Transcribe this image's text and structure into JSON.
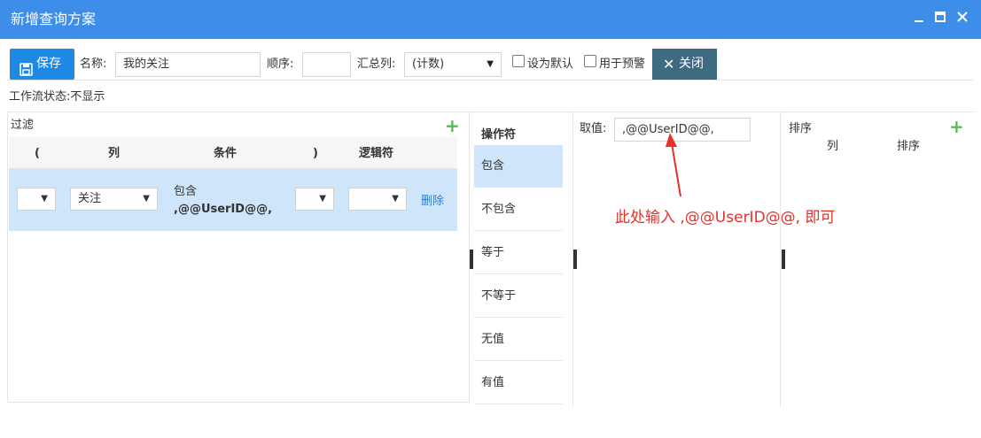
{
  "window": {
    "title": "新增查询方案",
    "minimize_icon": "minimize-icon",
    "maximize_icon": "maximize-icon",
    "close_icon": "close-icon"
  },
  "toolbar": {
    "save_label": "保存",
    "name_label": "名称:",
    "name_value": "我的关注",
    "order_label": "顺序:",
    "order_value": "",
    "summary_label": "汇总列:",
    "summary_value": "(计数)",
    "default_label": "设为默认",
    "warning_label": "用于预警",
    "close_label": "关闭"
  },
  "workflow_status": "工作流状态:不显示",
  "filter": {
    "title": "过滤",
    "columns": [
      "(",
      "列",
      "条件",
      ")",
      "逻辑符"
    ],
    "rows": [
      {
        "open_paren": "",
        "column": "关注",
        "condition_op": "包含",
        "condition_value": ",@@UserID@@,",
        "close_paren": "",
        "logic": "",
        "delete_label": "删除"
      }
    ]
  },
  "operators": {
    "title": "操作符",
    "items": [
      "包含",
      "不包含",
      "等于",
      "不等于",
      "无值",
      "有值"
    ],
    "selected": "包含"
  },
  "value": {
    "label": "取值:",
    "input_value": ",@@UserID@@,"
  },
  "annotation": {
    "text": "此处输入 ,@@UserID@@, 即可",
    "color": "#e8302a"
  },
  "sort": {
    "title": "排序",
    "columns": [
      "列",
      "排序"
    ]
  },
  "colors": {
    "titlebar": "#3d8ee8",
    "save_button": "#1e88e5",
    "close_button": "#3e6a82",
    "selected_row": "#cfe6fa",
    "add": "#5cb85c",
    "link": "#2f7fc8"
  }
}
